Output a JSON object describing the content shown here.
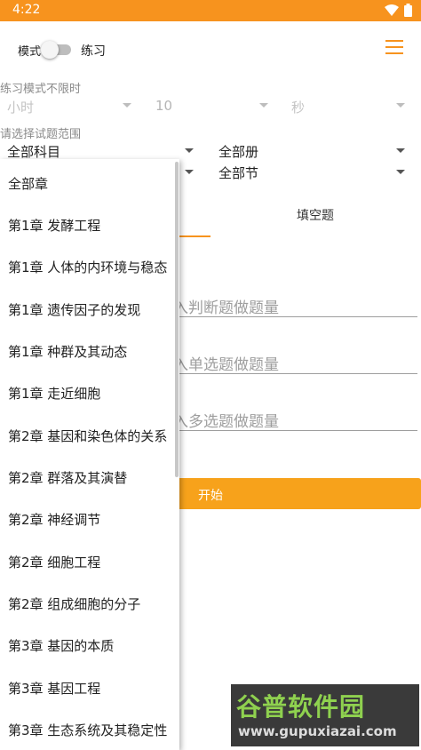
{
  "status_bar": {
    "time": "4:22"
  },
  "header": {
    "mode_label": "模式",
    "mode_toggle_label": "练习"
  },
  "timer": {
    "title": "练习模式不限时",
    "hours_placeholder": "小时",
    "minutes_value": "10",
    "seconds_placeholder": "秒"
  },
  "range": {
    "title": "请选择试题范围",
    "subject_value": "全部科目",
    "volume_value": "全部册",
    "section_value": "全部节"
  },
  "tabs": {
    "fill_blank": "填空题"
  },
  "inputs": {
    "judge_placeholder": "输入判断题做题量",
    "single_placeholder": "输入单选题做题量",
    "multi_placeholder": "输入多选题做题量"
  },
  "start_button": "开始",
  "chapter_dropdown": {
    "items": [
      "全部章",
      "第1章 发酵工程",
      "第1章 人体的内环境与稳态",
      "第1章 遗传因子的发现",
      "第1章 种群及其动态",
      "第1章 走近细胞",
      "第2章 基因和染色体的关系",
      "第2章 群落及其演替",
      "第2章 神经调节",
      "第2章 细胞工程",
      "第2章 组成细胞的分子",
      "第3章 基因的本质",
      "第3章 基因工程",
      "第3章 生态系统及其稳定性"
    ]
  },
  "watermark": {
    "brand": "谷普软件园",
    "url": "www.gupuxiazai.com"
  },
  "colors": {
    "accent": "#f7931e",
    "button": "#f7a21b"
  }
}
